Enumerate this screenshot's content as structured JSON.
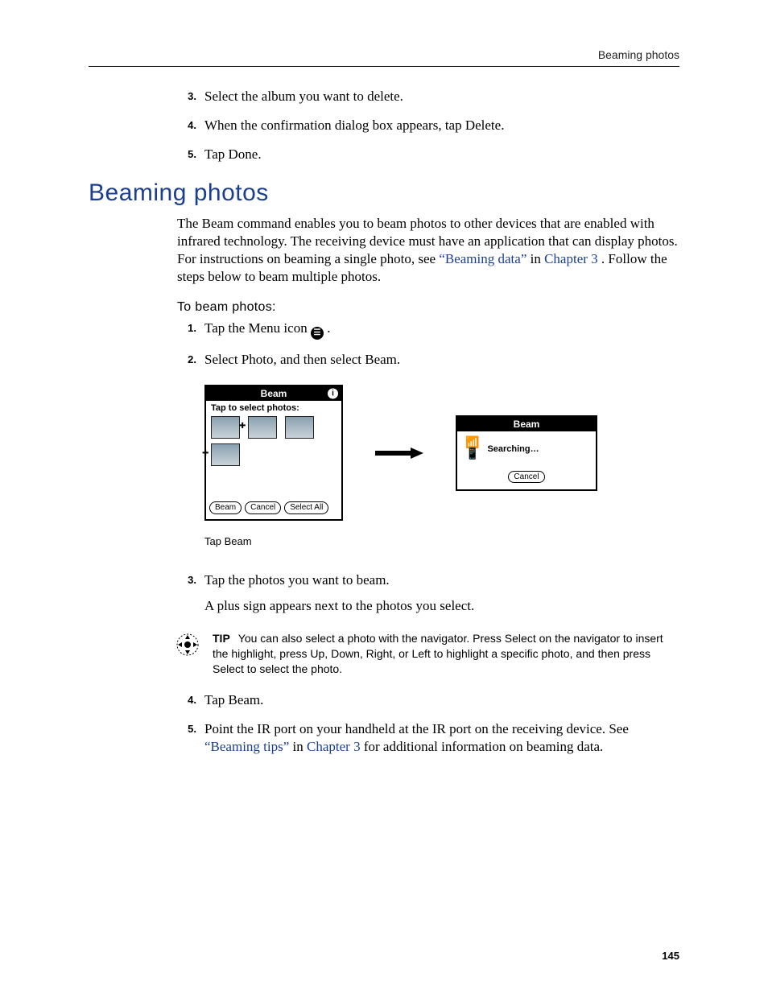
{
  "runningHead": "Beaming photos",
  "prevSteps": [
    {
      "num": "3.",
      "text": "Select the album you want to delete."
    },
    {
      "num": "4.",
      "text": "When the confirmation dialog box appears, tap Delete."
    },
    {
      "num": "5.",
      "text": "Tap Done."
    }
  ],
  "heading": "Beaming photos",
  "intro": {
    "preLink1": "The Beam command enables you to beam photos to other devices that are enabled with infrared technology. The receiving device must have an application that can display photos. For instructions on beaming a single photo, see ",
    "link1": "“Beaming data”",
    "betweenLinks": " in ",
    "link2": "Chapter 3",
    "postLink2": ". Follow the steps below to beam multiple photos."
  },
  "subhead": "To beam photos:",
  "steps12": [
    {
      "num": "1.",
      "pre": "Tap the Menu icon ",
      "post": "."
    },
    {
      "num": "2.",
      "text": "Select Photo, and then select Beam."
    }
  ],
  "figure": {
    "shot1": {
      "title": "Beam",
      "subtitle": "Tap to select photos:",
      "buttons": {
        "beam": "Beam",
        "cancel": "Cancel",
        "selectAll": "Select All"
      }
    },
    "caption": "Tap Beam",
    "shot2": {
      "title": "Beam",
      "status": "Searching…",
      "cancel": "Cancel"
    }
  },
  "steps3": {
    "num": "3.",
    "text": "Tap the photos you want to beam.",
    "sub": "A plus sign appears next to the photos you select."
  },
  "tip": {
    "label": "TIP",
    "text": "You can also select a photo with the navigator. Press Select on the navigator to insert the highlight, press Up, Down, Right, or Left to highlight a specific photo, and then press Select to select the photo."
  },
  "steps45": [
    {
      "num": "4.",
      "text": "Tap Beam."
    },
    {
      "num": "5.",
      "pre": "Point the IR port on your handheld at the IR port on the receiving device. See ",
      "link1": "“Beaming tips”",
      "mid": " in ",
      "link2": "Chapter 3",
      "post": " for additional information on beaming data."
    }
  ],
  "pageNum": "145",
  "menuIconGlyph": "☰"
}
